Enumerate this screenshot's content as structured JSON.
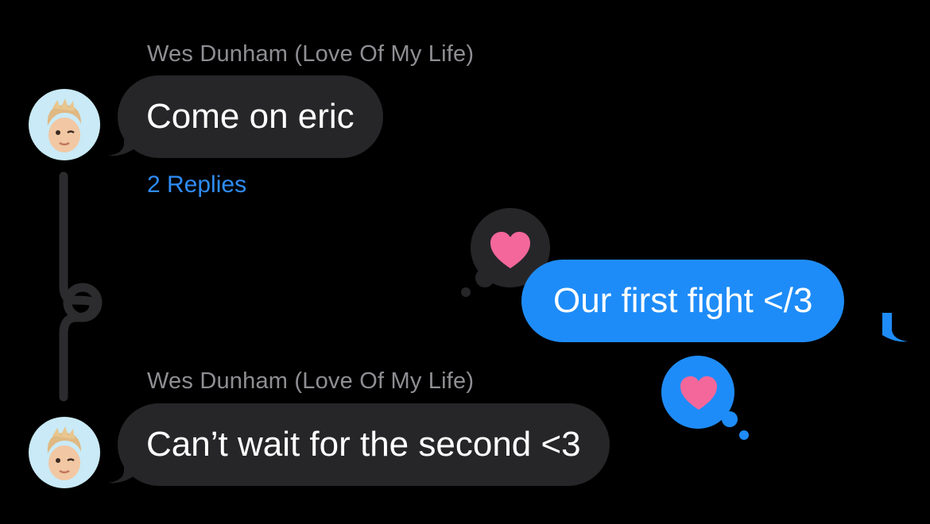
{
  "conversation": {
    "messages": [
      {
        "sender": "Wes Dunham (Love Of My Life)",
        "text": "Come on eric",
        "direction": "incoming",
        "replies_label": "2 Replies"
      },
      {
        "text": "Our first fight </3",
        "direction": "outgoing",
        "tapback": "heart-icon"
      },
      {
        "sender": "Wes Dunham (Love Of My Life)",
        "text": "Can’t wait for the second <3",
        "direction": "incoming",
        "tapback": "heart-icon"
      }
    ]
  },
  "colors": {
    "background": "#000000",
    "incoming_bubble": "#262628",
    "outgoing_bubble": "#1e8cf8",
    "sender_name": "#8e8e93",
    "replies_link": "#2f8cf6",
    "heart": "#f4679b",
    "thread_line": "#2c2c2e"
  }
}
